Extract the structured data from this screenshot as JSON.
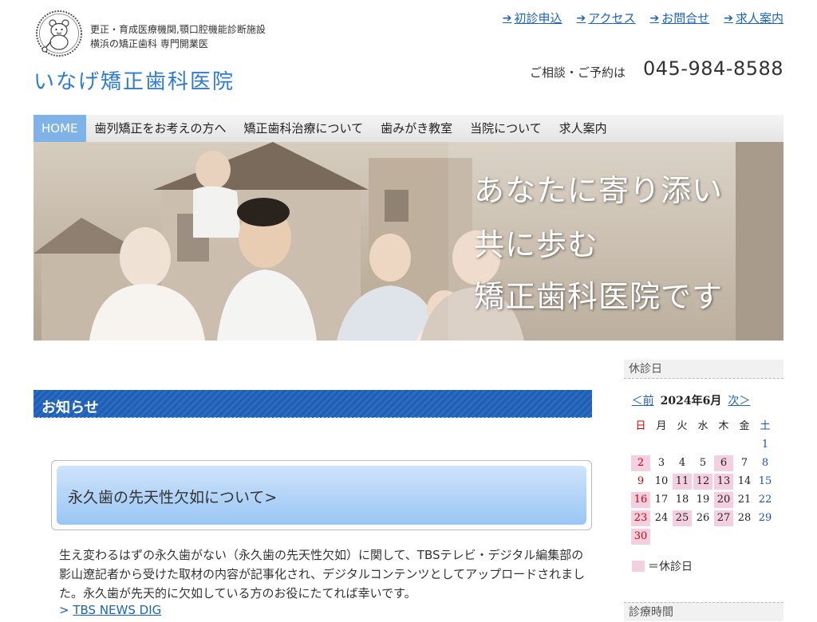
{
  "header": {
    "tagline_line1": "更正・育成医療機関,顎口腔機能診断施設",
    "tagline_line2": "横浜の矯正歯科 専門開業医",
    "site_title": "いなげ矯正歯科医院",
    "top_links": [
      "初診申込",
      "アクセス",
      "お問合せ",
      "求人案内"
    ],
    "contact_label": "ご相談・ご予約は",
    "phone": "045-984-8588"
  },
  "nav": {
    "items": [
      "HOME",
      "歯列矯正をお考えの方へ",
      "矯正歯科治療について",
      "歯みがき教室",
      "当院について",
      "求人案内"
    ]
  },
  "hero": {
    "line1": "あなたに寄り添い",
    "line2": "共に歩む",
    "line3": "矯正歯科医院です"
  },
  "news": {
    "title": "お知らせ",
    "article_heading": "永久歯の先天性欠如について>",
    "article_body": "生え変わるはずの永久歯がない（永久歯の先天性欠如）に関して、TBSテレビ・デジタル編集部の影山遼記者から受けた取材の内容が記事化され、デジタルコンテンツとしてアップロードされました。永久歯が先天的に欠如している方のお役にたてれば幸いです。",
    "link_prefix": ">",
    "link_text": "TBS NEWS DIG"
  },
  "sidebar": {
    "closed_days_title": "休診日",
    "prev": "＜前",
    "month": "2024年6月",
    "next": "次＞",
    "weekdays": [
      "日",
      "月",
      "火",
      "水",
      "木",
      "金",
      "土"
    ],
    "weeks": [
      [
        "",
        "",
        "",
        "",
        "",
        "",
        "1"
      ],
      [
        "2",
        "3",
        "4",
        "5",
        "6",
        "7",
        "8"
      ],
      [
        "9",
        "10",
        "11",
        "12",
        "13",
        "14",
        "15"
      ],
      [
        "16",
        "17",
        "18",
        "19",
        "20",
        "21",
        "22"
      ],
      [
        "23",
        "24",
        "25",
        "26",
        "27",
        "28",
        "29"
      ],
      [
        "30",
        "",
        "",
        "",
        "",
        "",
        ""
      ]
    ],
    "closed_days": [
      "2",
      "6",
      "11",
      "12",
      "13",
      "16",
      "20",
      "23",
      "25",
      "27",
      "30"
    ],
    "legend_text": "＝休診日",
    "hours_title": "診療時間"
  },
  "colors": {
    "accent": "#2e7bd6",
    "link": "#1d64b8",
    "nav_active": "#7fb2e6",
    "news_bar": "#1f5eb3",
    "closed_day": "#f3cfe0",
    "sunday": "#d40000",
    "saturday": "#1d4fb8"
  },
  "icons": {
    "logo": "bear-mascot-logo",
    "link_arrow": "arrow-right-icon"
  }
}
